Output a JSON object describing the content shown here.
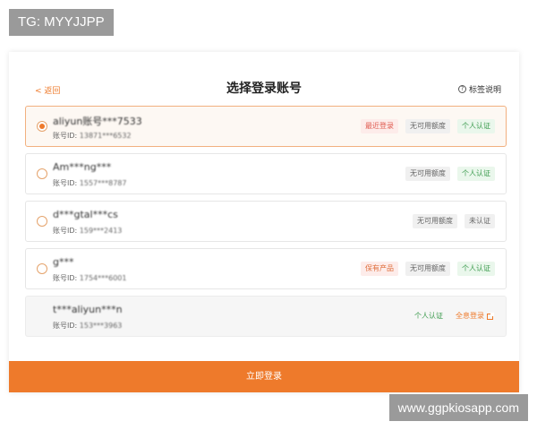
{
  "watermark": {
    "top": "TG: MYYJJPP",
    "bottom": "www.ggpkiosapp.com"
  },
  "header": {
    "back_label": "< 返回",
    "title": "选择登录账号",
    "help_label": "标签说明",
    "help_icon": "question-circle-icon"
  },
  "id_prefix": "账号ID: ",
  "accounts": [
    {
      "name": "aliyun账号***7533",
      "id_value": "13871***6532",
      "selected": true,
      "tags": [
        "最近登录",
        "无可用额度",
        "个人认证"
      ]
    },
    {
      "name": "Am***ng***",
      "id_value": "1557***8787",
      "selected": false,
      "tags": [
        "无可用额度",
        "个人认证"
      ]
    },
    {
      "name": "d***gtal***cs",
      "id_value": "159***2413",
      "selected": false,
      "tags": [
        "无可用额度",
        "未认证"
      ]
    },
    {
      "name": "g***",
      "id_value": "1754***6001",
      "selected": false,
      "tags": [
        "保有产品",
        "无可用额度",
        "个人认证"
      ]
    },
    {
      "name": "t***aliyun***n",
      "id_value": "153***3963",
      "selected": false,
      "disabled": true,
      "tags": [
        "个人认证"
      ],
      "link_label": "全息登录",
      "link_icon": "external-link-icon"
    }
  ],
  "login_button": "立即登录",
  "colors": {
    "accent": "#ee7a2b",
    "selected_border": "#f2b07f",
    "tag_red": "#e05a4f",
    "tag_green": "#3a9a4c"
  }
}
